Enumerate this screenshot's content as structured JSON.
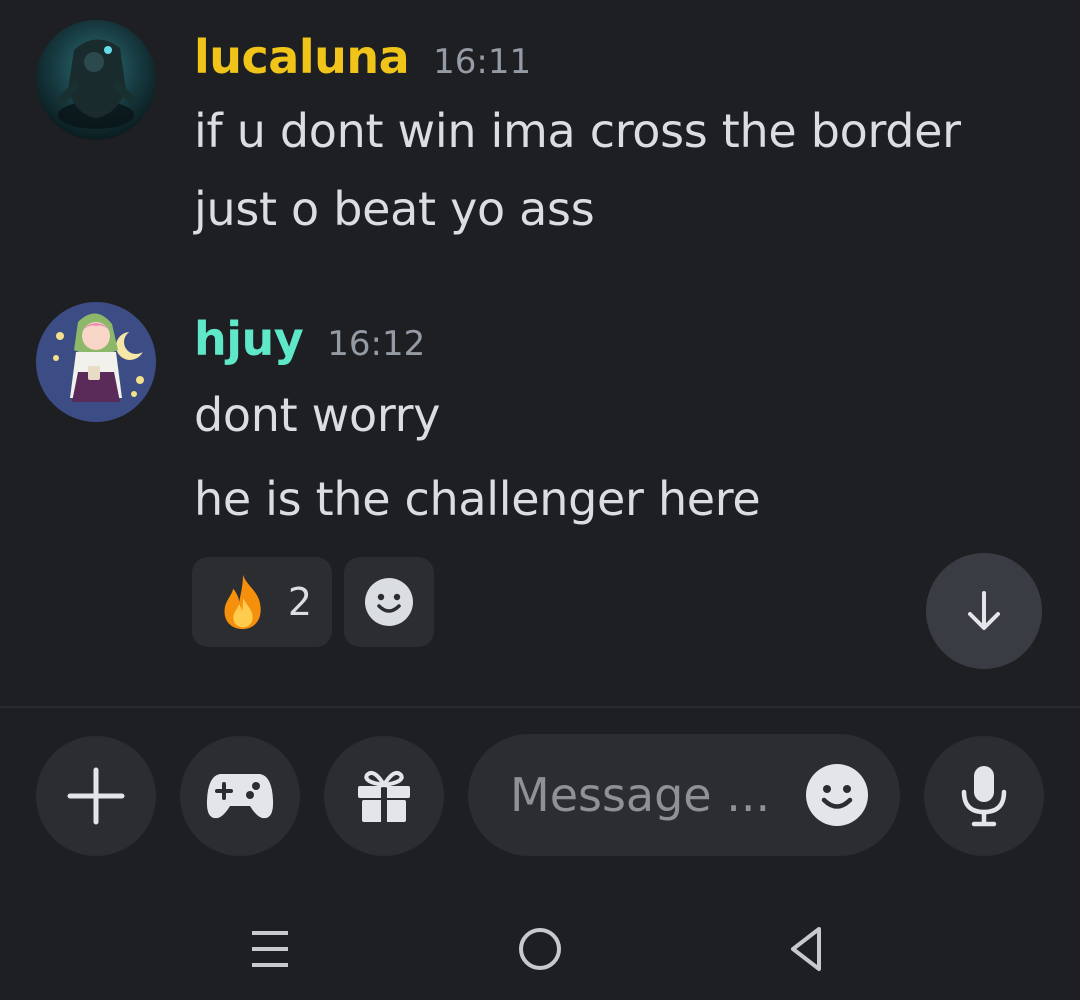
{
  "colors": {
    "background": "#1e1f23",
    "username_lucaluna": "#f0c419",
    "username_hjuy": "#5fe8c8",
    "timestamp": "#949ba4",
    "surface": "#2b2d31"
  },
  "messages": [
    {
      "username": "lucaluna",
      "time": "16:11",
      "avatar_icon": "dark-character-avatar",
      "lines": [
        "if u dont win ima cross the border",
        "just o beat yo ass"
      ]
    },
    {
      "username": "hjuy",
      "time": "16:12",
      "avatar_icon": "anime-girl-avatar",
      "lines": [
        "dont worry",
        "he is the challenger here"
      ],
      "reactions": [
        {
          "icon": "fire-emoji",
          "count": "2"
        }
      ]
    }
  ],
  "composer": {
    "placeholder": "Message ...",
    "buttons": [
      "plus-icon",
      "gamepad-icon",
      "gift-icon",
      "smile-icon",
      "microphone-icon"
    ]
  },
  "system_nav": [
    "recent-apps-icon",
    "home-icon",
    "back-icon"
  ]
}
